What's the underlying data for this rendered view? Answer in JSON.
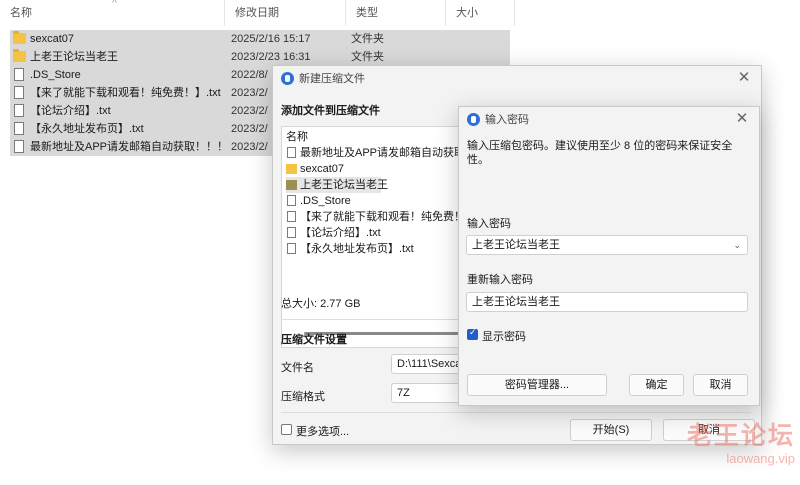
{
  "explorer": {
    "columns": {
      "name": "名称",
      "date": "修改日期",
      "type": "类型",
      "size": "大小"
    },
    "files": [
      {
        "name": "sexcat07",
        "date": "2025/2/16 15:17",
        "type": "文件夹",
        "icon": "folder-icon"
      },
      {
        "name": "上老王论坛当老王",
        "date": "2023/2/23 16:31",
        "type": "文件夹",
        "icon": "folder-icon"
      },
      {
        "name": ".DS_Store",
        "date": "2022/8/",
        "type": "",
        "icon": "file-icon"
      },
      {
        "name": "【来了就能下载和观看！纯免费！】.txt",
        "date": "2023/2/",
        "type": "",
        "icon": "file-icon"
      },
      {
        "name": "【论坛介绍】.txt",
        "date": "2023/2/",
        "type": "",
        "icon": "file-icon"
      },
      {
        "name": "【永久地址发布页】.txt",
        "date": "2023/2/",
        "type": "",
        "icon": "file-icon"
      },
      {
        "name": "最新地址及APP请发邮箱自动获取！！！",
        "date": "2023/2/",
        "type": "",
        "icon": "file-icon"
      }
    ]
  },
  "archive_dialog": {
    "title": "新建压缩文件",
    "add_section": "添加文件到压缩文件",
    "list_header": "名称",
    "list_items": [
      {
        "name": "最新地址及APP请发邮箱自动获取！",
        "icon": "file-icon"
      },
      {
        "name": "sexcat07",
        "icon": "folder-icon"
      },
      {
        "name": "上老王论坛当老王",
        "icon": "folder-icon"
      },
      {
        "name": ".DS_Store",
        "icon": "file-icon"
      },
      {
        "name": "【来了就能下载和观看！纯免费！】",
        "icon": "file-icon"
      },
      {
        "name": "【论坛介绍】.txt",
        "icon": "file-icon"
      },
      {
        "name": "【永久地址发布页】.txt",
        "icon": "file-icon"
      }
    ],
    "total_size": "总大小: 2.77 GB",
    "settings_section": "压缩文件设置",
    "filename_label": "文件名",
    "filename_value": "D:\\111\\Sexca",
    "format_label": "压缩格式",
    "format_value": "7Z",
    "more_options": "更多选项...",
    "start_button": "开始(S)",
    "cancel_button": "取消"
  },
  "password_dialog": {
    "title": "输入密码",
    "note": "输入压缩包密码。建议使用至少 8 位的密码来保证安全性。",
    "password_label": "输入密码",
    "password_value": "上老王论坛当老王",
    "reenter_label": "重新输入密码",
    "reenter_value": "上老王论坛当老王",
    "show_password": "显示密码",
    "show_password_checked": true,
    "manager_button": "密码管理器...",
    "ok_button": "确定",
    "cancel_button": "取消"
  },
  "watermark": {
    "text": "老王论坛",
    "url": "laowang.vip"
  }
}
